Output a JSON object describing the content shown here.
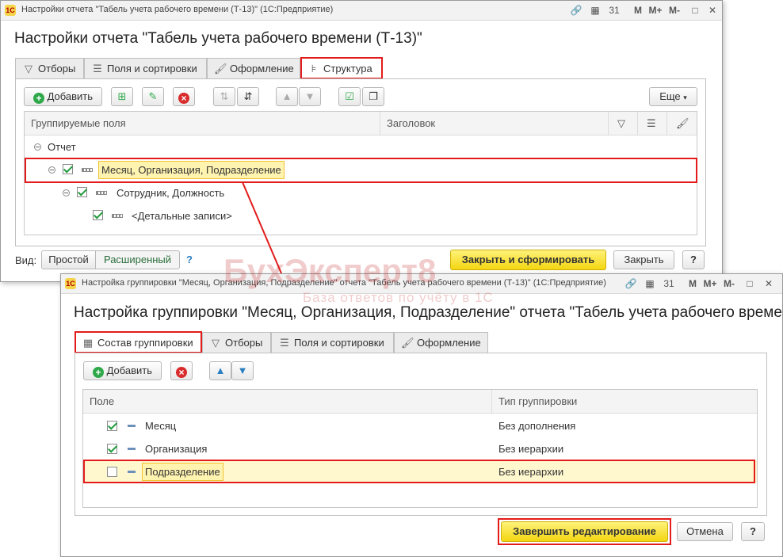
{
  "window1": {
    "titlebar": "Настройки отчета \"Табель учета рабочего времени (Т-13)\" (1С:Предприятие)",
    "title": "Настройки отчета \"Табель учета рабочего времени (Т-13)\"",
    "titlebar_buttons": [
      "M",
      "M+",
      "M-"
    ],
    "tabs": [
      "Отборы",
      "Поля и сортировки",
      "Оформление",
      "Структура"
    ],
    "toolbar": {
      "add": "Добавить",
      "more": "Еще"
    },
    "grid_headers": {
      "fields": "Группируемые поля",
      "title": "Заголовок"
    },
    "tree": [
      "Отчет",
      "Месяц, Организация, Подразделение",
      "Сотрудник, Должность",
      "<Детальные записи>"
    ],
    "view_label": "Вид:",
    "view_options": [
      "Простой",
      "Расширенный"
    ],
    "help": "?",
    "close_generate": "Закрыть и сформировать",
    "close": "Закрыть"
  },
  "window2": {
    "titlebar": "Настройка группировки \"Месяц, Организация, Подразделение\" отчета \"Табель учета рабочего времени (Т-13)\" (1С:Предприятие)",
    "title": "Настройка группировки \"Месяц, Организация, Подразделение\" отчета \"Табель учета рабочего време...",
    "titlebar_buttons": [
      "M",
      "M+",
      "M-"
    ],
    "tabs": [
      "Состав группировки",
      "Отборы",
      "Поля и сортировки",
      "Оформление"
    ],
    "toolbar": {
      "add": "Добавить"
    },
    "grid_headers": {
      "field": "Поле",
      "type": "Тип группировки"
    },
    "rows": [
      {
        "field": "Месяц",
        "type": "Без дополнения",
        "checked": true
      },
      {
        "field": "Организация",
        "type": "Без иерархии",
        "checked": true
      },
      {
        "field": "Подразделение",
        "type": "Без иерархии",
        "checked": false
      }
    ],
    "finish": "Завершить редактирование",
    "cancel": "Отмена",
    "help": "?"
  },
  "watermark": {
    "brand": "БухЭксперт8",
    "tagline": "База ответов по учёту в 1С"
  },
  "colors": {
    "highlight": "#e31b1b",
    "selection": "#fff3b0",
    "primary_button": "#f3d611"
  }
}
